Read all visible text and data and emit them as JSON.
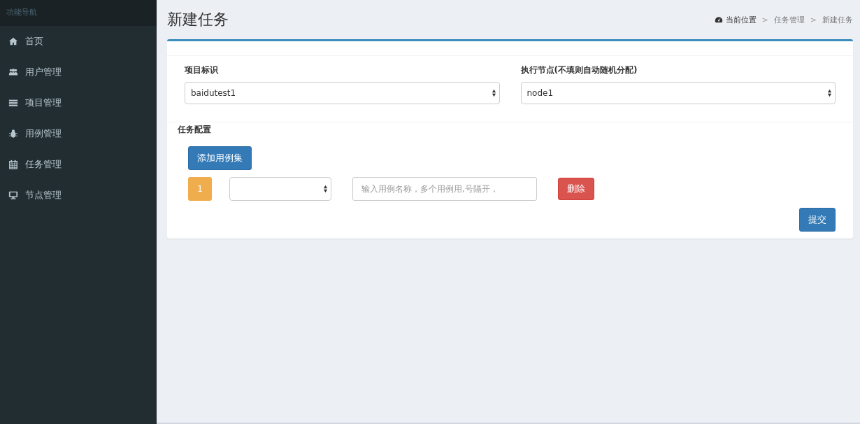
{
  "sidebar": {
    "header": "功能导航",
    "items": [
      {
        "label": "首页"
      },
      {
        "label": "用户管理"
      },
      {
        "label": "项目管理"
      },
      {
        "label": "用例管理"
      },
      {
        "label": "任务管理"
      },
      {
        "label": "节点管理"
      }
    ]
  },
  "page": {
    "title": "新建任务",
    "breadcrumb": [
      "当前位置",
      "任务管理",
      "新建任务"
    ],
    "separator": ">"
  },
  "form": {
    "fields": [
      {
        "label": "项目标识",
        "value": "baidutest1"
      },
      {
        "label": "执行节点(不填则自动随机分配)",
        "value": "node1"
      }
    ],
    "section_label": "任务配置",
    "add_button": "添加用例集",
    "rows": [
      {
        "index": "1",
        "select_value": "",
        "placeholder": "输入用例名称，多个用例用,号隔开，",
        "delete_button": "删除"
      }
    ],
    "submit_button": "提交"
  }
}
